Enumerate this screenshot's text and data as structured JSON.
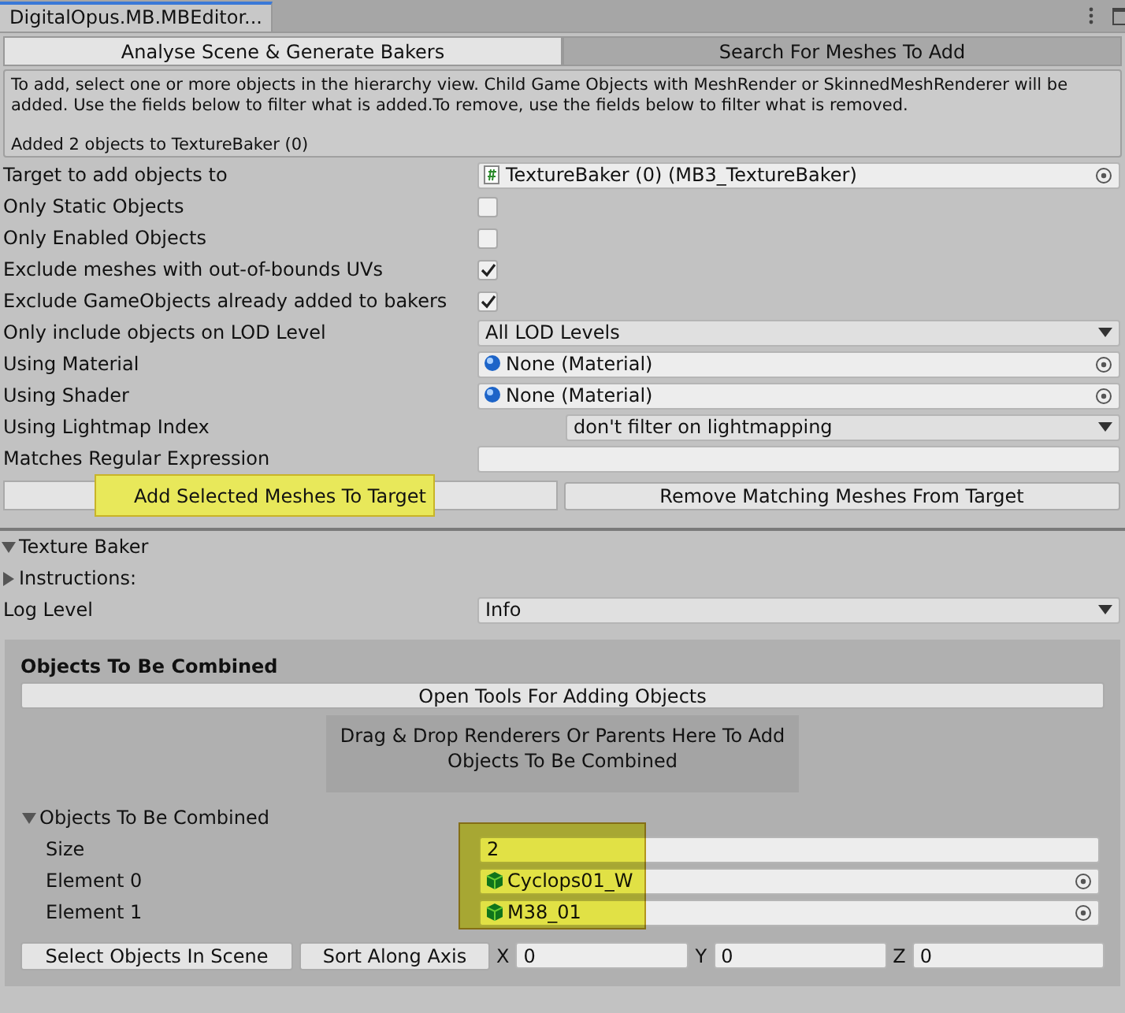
{
  "window": {
    "tab": "DigitalOpus.MB.MBEditor..."
  },
  "toolbar": [
    {
      "label": "Analyse Scene & Generate Bakers",
      "selected": false
    },
    {
      "label": "Search For Meshes To Add",
      "selected": true
    }
  ],
  "help": {
    "text": "To add, select one or more objects in the hierarchy view. Child Game Objects with MeshRender or SkinnedMeshRenderer will be added. Use the fields below to filter what is added.To remove, use the fields below to filter what is removed.",
    "message": "Added 2 objects to TextureBaker (0)"
  },
  "properties": [
    {
      "label": "Target to add objects to",
      "kind": "script-object",
      "value": "TextureBaker (0) (MB3_TextureBaker)"
    },
    {
      "label": "Only Static Objects",
      "kind": "toggle",
      "checked": false
    },
    {
      "label": "Only Enabled Objects",
      "kind": "toggle",
      "checked": false
    },
    {
      "label": "Exclude meshes with out-of-bounds UVs",
      "kind": "toggle",
      "checked": true
    },
    {
      "label": "Exclude GameObjects already added to bakers",
      "kind": "toggle",
      "checked": true
    },
    {
      "label": "Only include objects on LOD Level",
      "kind": "popup",
      "value": "All LOD Levels"
    },
    {
      "label": "Using Material",
      "kind": "material-object",
      "value": "None (Material)"
    },
    {
      "label": "Using Shader",
      "kind": "material-object",
      "value": "None (Material)"
    },
    {
      "label": "Using Lightmap Index",
      "kind": "popup-inset",
      "value": "don't filter on lightmapping"
    },
    {
      "label": "Matches Regular Expression",
      "kind": "text"
    }
  ],
  "actions": [
    {
      "label": "Add Selected Meshes To Target",
      "highlighted": true
    },
    {
      "label": "Remove Matching Meshes From Target",
      "highlighted": false
    }
  ],
  "inspector": {
    "title": "Texture Baker",
    "expanded": true,
    "instructions": {
      "label": "Instructions:",
      "expanded": false
    },
    "log_level": {
      "label": "Log Level",
      "value": "Info"
    },
    "objects_box": {
      "heading": "Objects To Be Combined",
      "open_button": "Open Tools For Adding Objects",
      "drop_area": "Drag & Drop Renderers Or Parents Here To Add Objects To Be Combined",
      "list": {
        "label": "Objects To Be Combined",
        "expanded": true,
        "highlighted": true,
        "size_label": "Size",
        "size": "2",
        "elements": [
          {
            "label": "Element 0",
            "value": "Cyclops01_W"
          },
          {
            "label": "Element 1",
            "value": "M38_01"
          }
        ]
      },
      "select_button": "Select Objects In Scene",
      "sort_button": "Sort Along Axis",
      "axes": [
        {
          "label": "X",
          "value": "0"
        },
        {
          "label": "Y",
          "value": "0"
        },
        {
          "label": "Z",
          "value": "0"
        }
      ]
    }
  }
}
